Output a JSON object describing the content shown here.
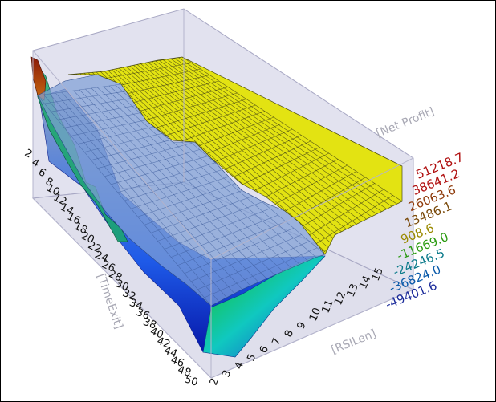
{
  "chart_data": {
    "type": "surface",
    "title": "",
    "x_axis": {
      "title": "[TimeExit]",
      "ticks": [
        "2",
        "4",
        "6",
        "8",
        "10",
        "12",
        "14",
        "16",
        "18",
        "20",
        "22",
        "24",
        "26",
        "28",
        "30",
        "32",
        "34",
        "36",
        "38",
        "40",
        "42",
        "44",
        "46",
        "48",
        "50"
      ]
    },
    "y_axis": {
      "title": "[RSILen]",
      "ticks": [
        "2",
        "3",
        "4",
        "5",
        "6",
        "7",
        "8",
        "9",
        "10",
        "11",
        "12",
        "13",
        "14",
        "15"
      ]
    },
    "z_axis": {
      "title": "[Net Profit]",
      "ticks": [
        "51218.7",
        "38641.2",
        "26063.6",
        "13486.1",
        "908.6",
        "-11669.0",
        "-24246.5",
        "-36824.0",
        "-49401.6"
      ],
      "tick_colors": [
        "#b01010",
        "#b01010",
        "#8e3a0a",
        "#7a4a0a",
        "#9a8a00",
        "#2a9a10",
        "#0a7a8a",
        "#0a5aaa",
        "#1a2a9a"
      ]
    },
    "zlim": [
      -49401.6,
      51218.7
    ],
    "colors": {
      "background": "#ffffff",
      "box": "#c9c9e0",
      "plateau": "#e3e312",
      "mesh": "#3c3c14"
    }
  }
}
